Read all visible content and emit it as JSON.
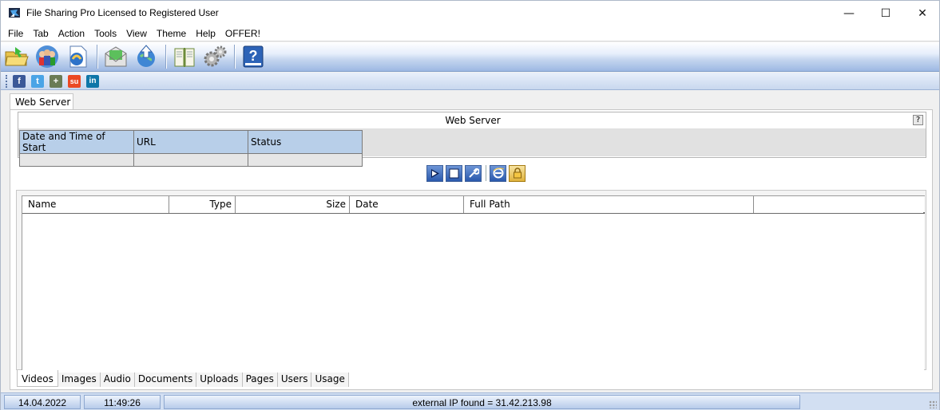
{
  "window": {
    "title": "File Sharing Pro Licensed to Registered User",
    "minimize_glyph": "—",
    "maximize_glyph": "☐",
    "close_glyph": "✕"
  },
  "menu": [
    "File",
    "Tab",
    "Action",
    "Tools",
    "View",
    "Theme",
    "Help",
    "OFFER!"
  ],
  "toolbar": {
    "icons": [
      "open-folder-icon",
      "users-icon",
      "document-icon",
      "mail-icon",
      "upload-globe-icon",
      "book-icon",
      "settings-gears-icon",
      "help-book-icon"
    ]
  },
  "social": {
    "facebook": "f",
    "twitter": "t",
    "googleplus": "+",
    "stumbleupon": "su",
    "linkedin": "in"
  },
  "tab": {
    "label": "Web Server"
  },
  "server": {
    "title": "Web Server",
    "help": "?",
    "columns": [
      "Date and Time of Start",
      "URL",
      "Status"
    ],
    "rows": [
      [
        "",
        "",
        ""
      ]
    ]
  },
  "controls": [
    "play-icon",
    "stop-icon",
    "wrench-icon",
    "ie-browser-icon",
    "lock-icon"
  ],
  "files": {
    "columns": [
      "Name",
      "Type",
      "Size",
      "Date",
      "Full Path",
      ""
    ]
  },
  "bottom_tabs": [
    "Videos",
    "Images",
    "Audio",
    "Documents",
    "Uploads",
    "Pages",
    "Users",
    "Usage"
  ],
  "status": {
    "date": "14.04.2022",
    "time": "11:49:26",
    "message": "external IP found = 31.42.213.98"
  },
  "colors": {
    "toolbar_blue": "#9db8e3",
    "header_blue": "#b8cfe9",
    "status_blue": "#d2dff2"
  }
}
